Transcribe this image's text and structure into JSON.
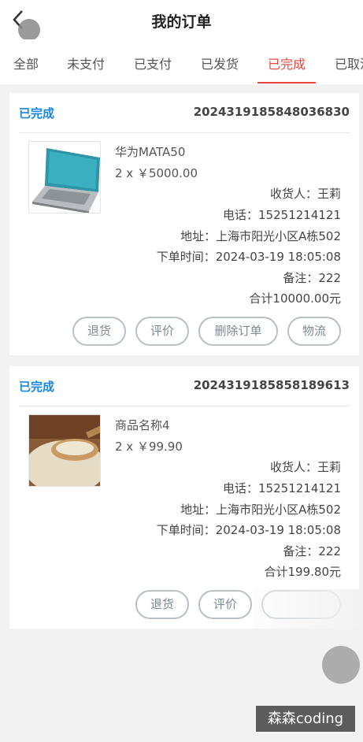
{
  "header": {
    "title": "我的订单",
    "back_icon": "chevron-left-icon"
  },
  "tabs": [
    {
      "label": "全部"
    },
    {
      "label": "未支付"
    },
    {
      "label": "已支付"
    },
    {
      "label": "已发货"
    },
    {
      "label": "已完成",
      "active": true
    },
    {
      "label": "已取消"
    }
  ],
  "orders": [
    {
      "status": "已完成",
      "order_no": "2024319185848036830",
      "product_name": "华为MATA50",
      "quantity_price": "2 x ￥5000.00",
      "receiver": "收货人：王莉",
      "phone": "电话：15251214121",
      "address": "地址：上海市阳光小区A栋502",
      "order_time": "下单时间：2024-03-19 18:05:08",
      "remark": "备注：222",
      "total": "合计10000.00元",
      "buttons": [
        "退货",
        "评价",
        "删除订单",
        "物流"
      ]
    },
    {
      "status": "已完成",
      "order_no": "2024319185858189613",
      "product_name": "商品名称4",
      "quantity_price": "2 x ￥99.90",
      "receiver": "收货人：王莉",
      "phone": "电话：15251214121",
      "address": "地址：上海市阳光小区A栋502",
      "order_time": "下单时间：2024-03-19 18:05:08",
      "remark": "备注：222",
      "total": "合计199.80元",
      "buttons": [
        "退货",
        "评价"
      ]
    }
  ],
  "watermark": "森森coding",
  "colors": {
    "accent": "#e5483a",
    "status": "#1a86e0",
    "background": "#f2f2f2"
  }
}
